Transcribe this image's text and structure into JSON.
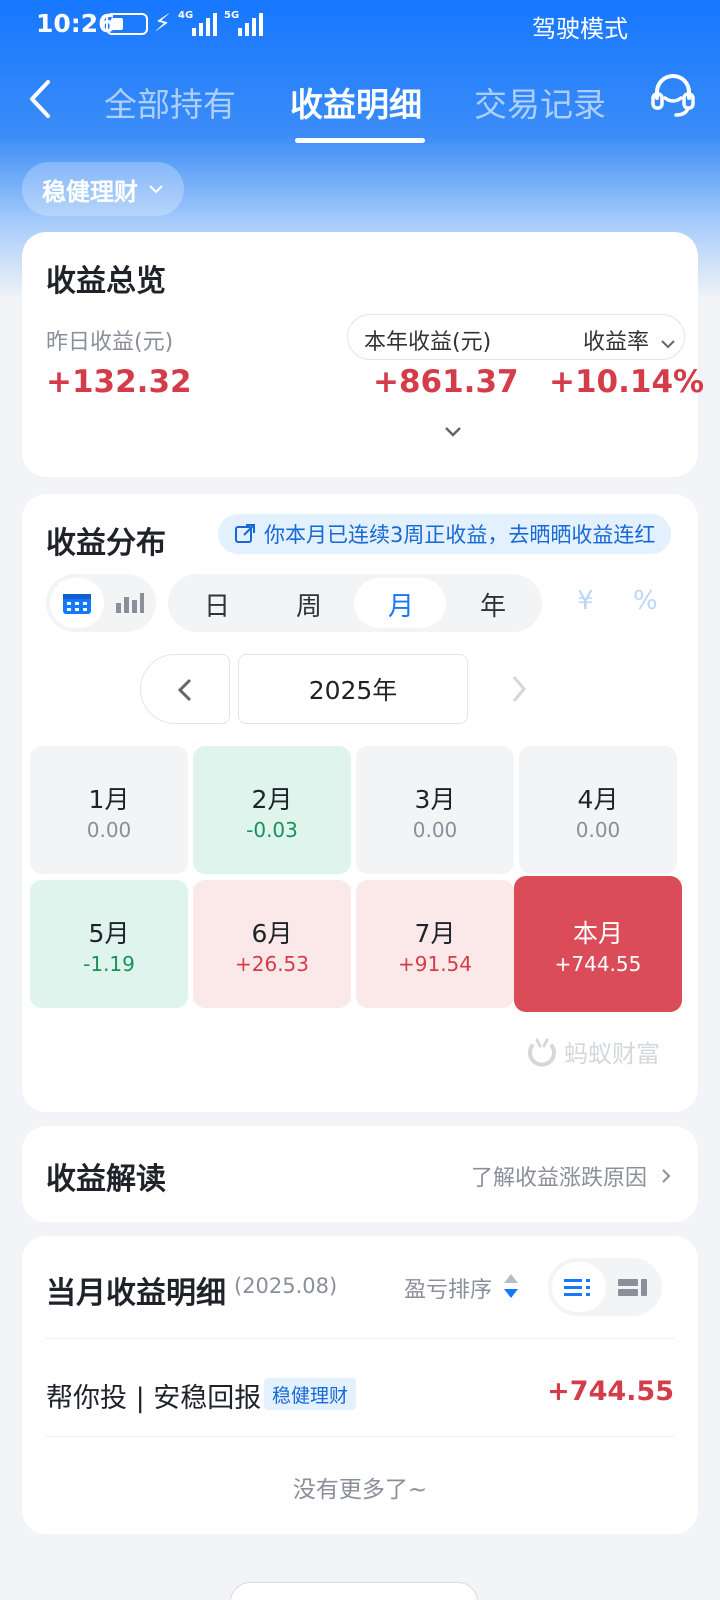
{
  "status_bar": {
    "time": "10:26",
    "network_4g": "4G",
    "network_5g": "5G",
    "mode": "驾驶模式"
  },
  "nav": {
    "tabs": [
      {
        "label": "全部持有"
      },
      {
        "label": "收益明细",
        "active": true
      },
      {
        "label": "交易记录"
      }
    ]
  },
  "filter": {
    "label": "稳健理财"
  },
  "overview": {
    "title": "收益总览",
    "yesterday_label": "昨日收益(元)",
    "yesterday_value": "+132.32",
    "year_label": "本年收益(元)",
    "year_value": "+861.37",
    "rate_label": "收益率",
    "rate_value": "+10.14%"
  },
  "distribution": {
    "title": "收益分布",
    "promo": "你本月已连续3周正收益，去晒晒收益连红",
    "periods": [
      "日",
      "周",
      "月",
      "年"
    ],
    "active_period": "月",
    "units": [
      "¥",
      "%"
    ],
    "year": "2025年",
    "months": [
      {
        "label": "1月",
        "value": "0.00",
        "state": "zero"
      },
      {
        "label": "2月",
        "value": "-0.03",
        "state": "neg"
      },
      {
        "label": "3月",
        "value": "0.00",
        "state": "zero"
      },
      {
        "label": "4月",
        "value": "0.00",
        "state": "zero"
      },
      {
        "label": "5月",
        "value": "-1.19",
        "state": "neg"
      },
      {
        "label": "6月",
        "value": "+26.53",
        "state": "pos"
      },
      {
        "label": "7月",
        "value": "+91.54",
        "state": "pos"
      },
      {
        "label": "本月",
        "value": "+744.55",
        "state": "cur"
      }
    ],
    "watermark": "蚂蚁财富"
  },
  "interpretation": {
    "title": "收益解读",
    "link": "了解收益涨跌原因"
  },
  "monthly_detail": {
    "title": "当月收益明细",
    "date": "(2025.08)",
    "sort_label": "盈亏排序",
    "rows": [
      {
        "name": "帮你投 | 安稳回报",
        "tag": "稳健理财",
        "value": "+744.55"
      }
    ],
    "end_text": "没有更多了~"
  },
  "colors": {
    "brand_blue": "#1677ff",
    "gain_red": "#d43c4a",
    "loss_green": "#15935a",
    "current_month_red": "#d94c58"
  }
}
